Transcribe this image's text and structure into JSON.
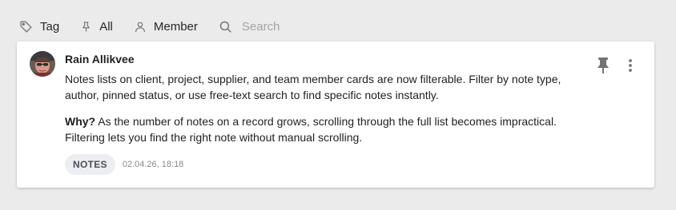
{
  "filters": {
    "tag_label": "Tag",
    "pin_label": "All",
    "member_label": "Member",
    "search_placeholder": "Search"
  },
  "note": {
    "author": "Rain Allikvee",
    "paragraph1": "Notes lists on client, project, supplier, and team member cards are now filterable. Filter by note type, author, pinned status, or use free-text search to find specific notes instantly.",
    "why_label": "Why?",
    "paragraph2": "As the number of notes on a record grows, scrolling through the full list becomes impractical. Filtering lets you find the right note without manual scrolling.",
    "badge": "NOTES",
    "timestamp": "02.04.26, 18:18",
    "pinned": true
  },
  "icons": {
    "tag": "tag-icon",
    "pin_filter": "pin-outline-icon",
    "member": "user-icon",
    "search": "search-icon",
    "pin_note": "pin-filled-icon",
    "more": "more-vertical-icon"
  },
  "colors": {
    "background": "#ebebeb",
    "card": "#ffffff",
    "badge_bg": "#eceef1",
    "badge_text": "#4a4f5a",
    "muted_text": "#8a8a8a",
    "icon": "#737373"
  }
}
